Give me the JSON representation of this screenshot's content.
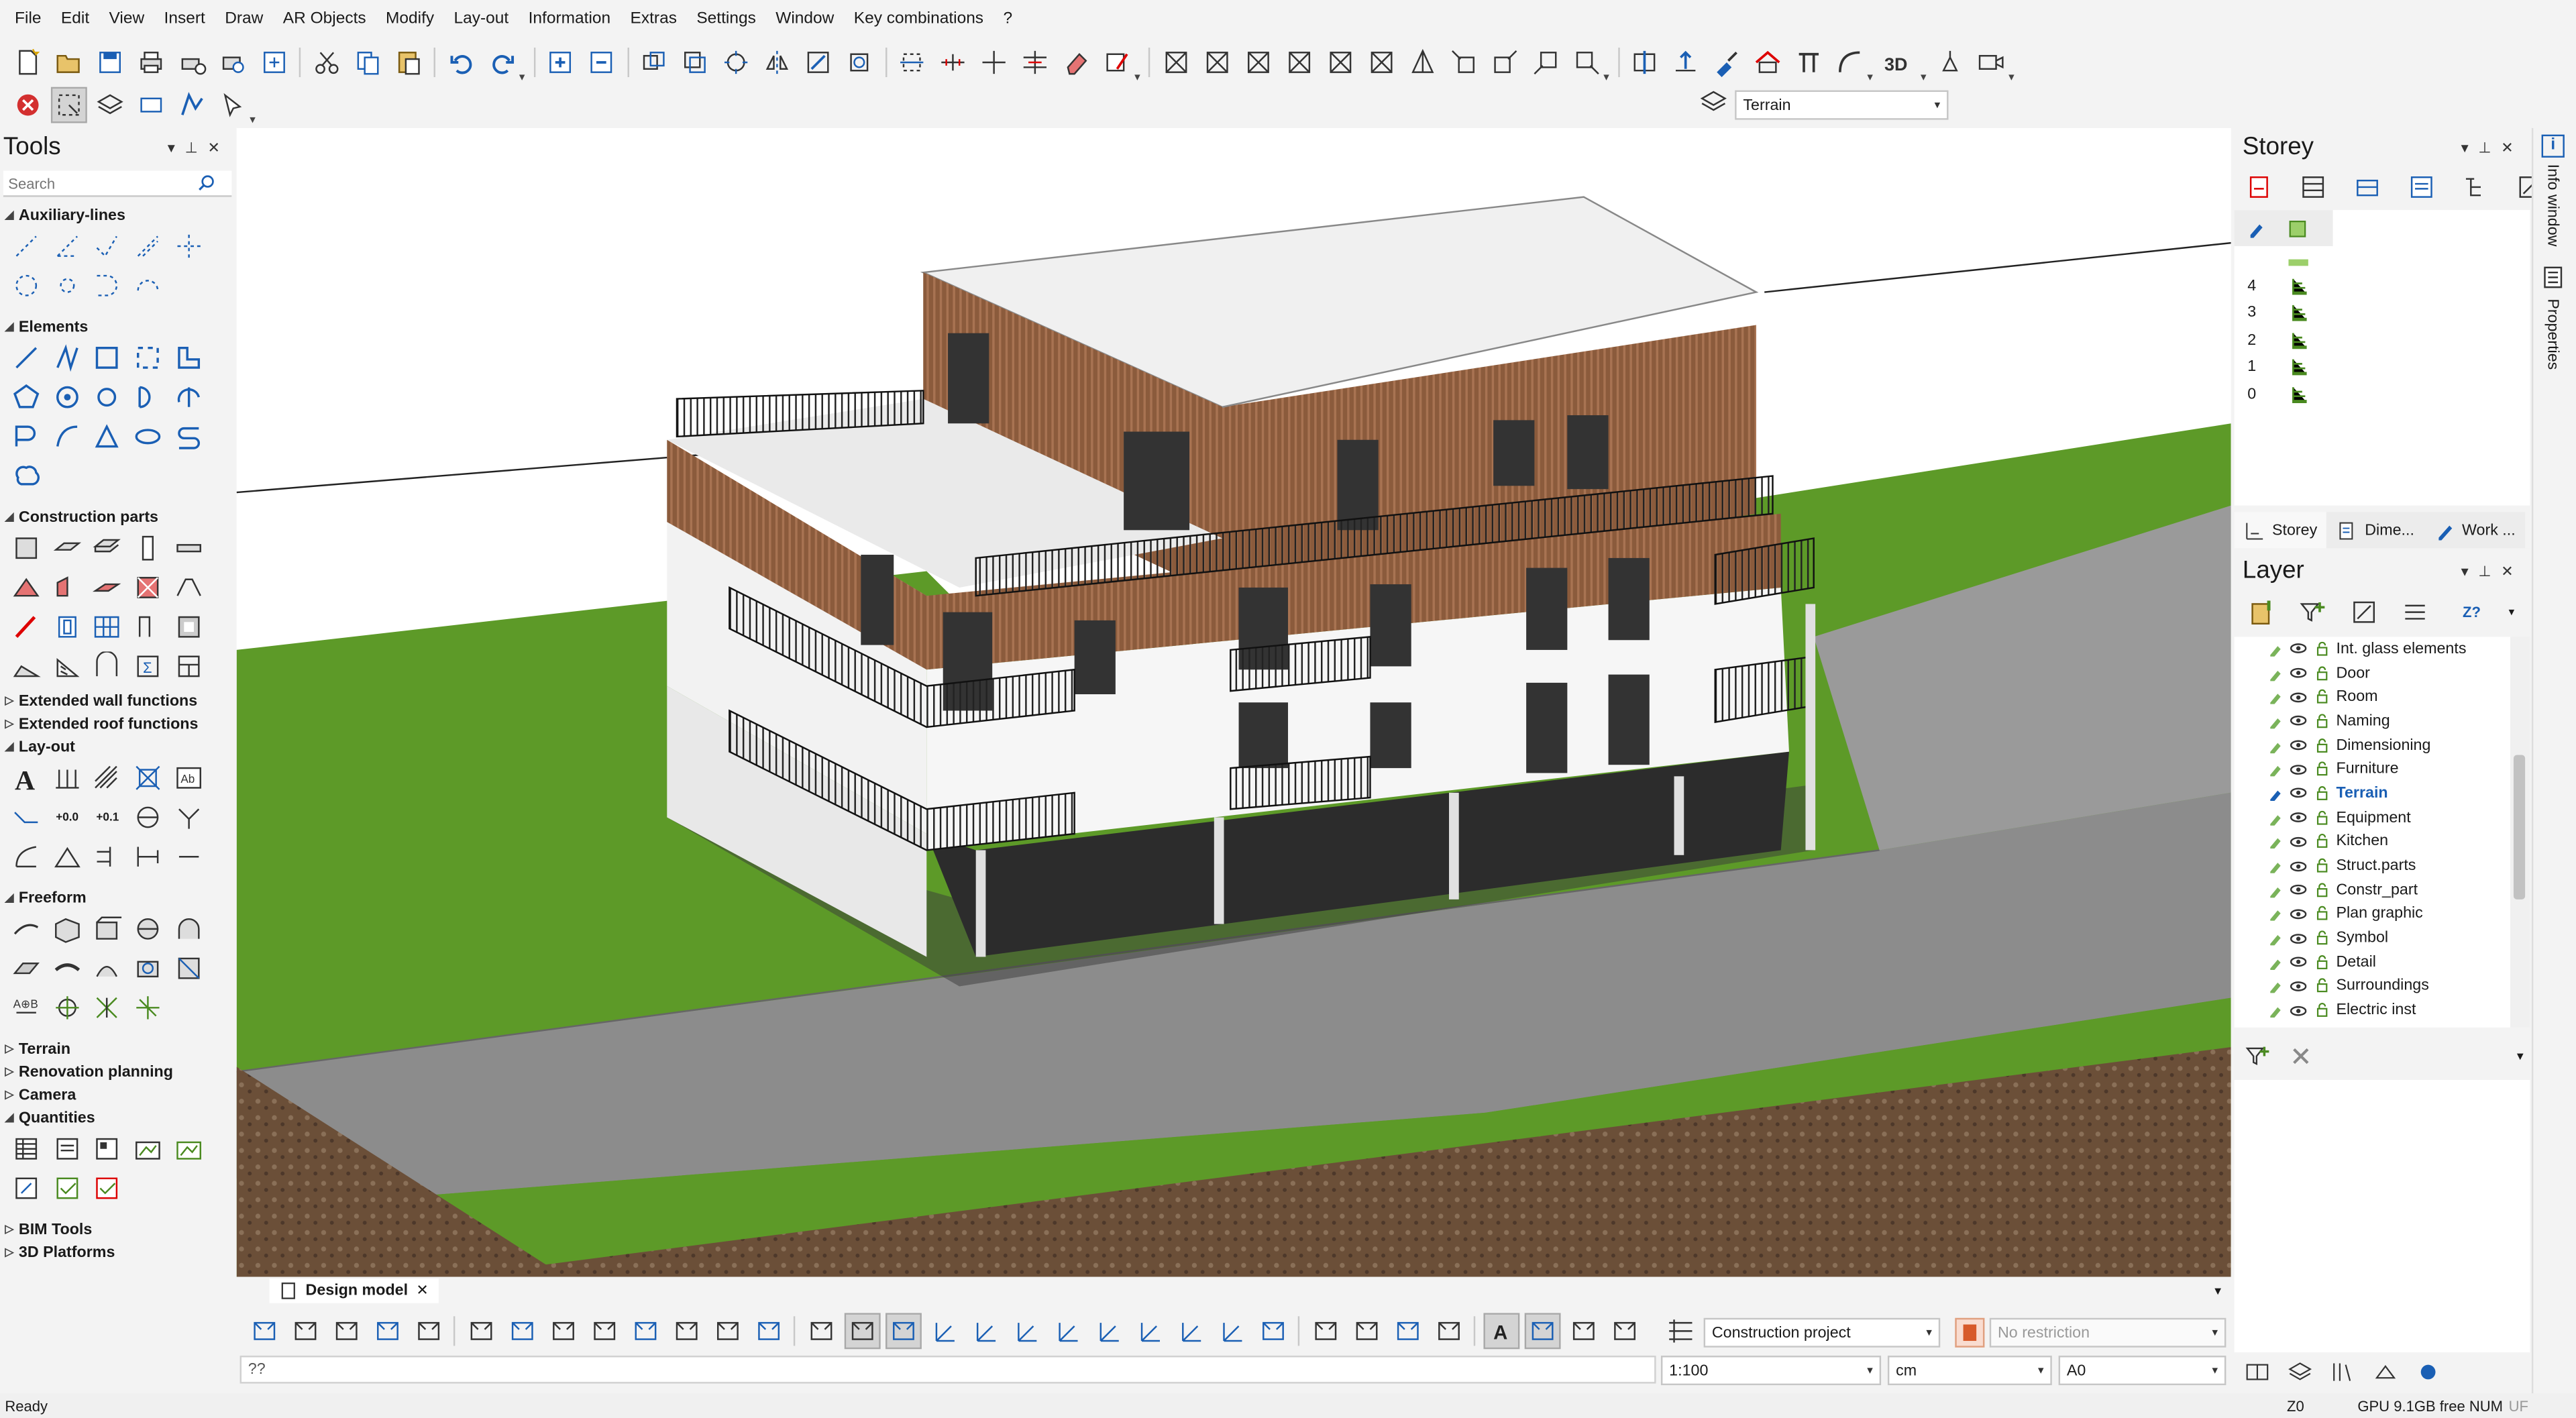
{
  "menu": [
    "File",
    "Edit",
    "View",
    "Insert",
    "Draw",
    "AR Objects",
    "Modify",
    "Lay-out",
    "Information",
    "Extras",
    "Settings",
    "Window",
    "Key combinations",
    "?"
  ],
  "toolbar": {
    "layer_combo_value": "Terrain"
  },
  "tools": {
    "title": "Tools",
    "search_placeholder": "Search",
    "categories": {
      "auxiliary": "Auxiliary-lines",
      "elements": "Elements",
      "construction": "Construction parts",
      "ext_wall": "Extended wall functions",
      "ext_roof": "Extended roof functions",
      "layout": "Lay-out",
      "freeform": "Freeform",
      "terrain": "Terrain",
      "renovation": "Renovation planning",
      "camera": "Camera",
      "quantities": "Quantities",
      "bim": "BIM Tools",
      "platforms": "3D Platforms"
    },
    "layout_labels": {
      "plus": "+0.0",
      "plus01": "+0.1"
    }
  },
  "storey": {
    "title": "Storey",
    "levels": [
      "4",
      "3",
      "2",
      "1",
      "0"
    ],
    "tabs": [
      "Storey",
      "Dime...",
      "Work ..."
    ]
  },
  "layer": {
    "title": "Layer",
    "sort_label": "Z?",
    "items": [
      {
        "name": "Int. glass elements",
        "active": false
      },
      {
        "name": "Door",
        "active": false
      },
      {
        "name": "Room",
        "active": false
      },
      {
        "name": "Naming",
        "active": false
      },
      {
        "name": "Dimensioning",
        "active": false
      },
      {
        "name": "Furniture",
        "active": false
      },
      {
        "name": "Terrain",
        "active": true
      },
      {
        "name": "Equipment",
        "active": false
      },
      {
        "name": "Kitchen",
        "active": false
      },
      {
        "name": "Struct.parts",
        "active": false
      },
      {
        "name": "Constr_part",
        "active": false
      },
      {
        "name": "Plan graphic",
        "active": false
      },
      {
        "name": "Symbol",
        "active": false
      },
      {
        "name": "Detail",
        "active": false
      },
      {
        "name": "Surroundings",
        "active": false
      },
      {
        "name": "Electric inst",
        "active": false
      }
    ]
  },
  "sidetabs": [
    "Info window",
    "Properties"
  ],
  "document_tab": "Design model",
  "bottom": {
    "project_combo": "Construction project",
    "restriction_placeholder": "No restriction",
    "command_value": "??",
    "scale": "1:100",
    "unit": "cm",
    "paper": "A0"
  },
  "status": {
    "left": "Ready",
    "z": "Z0",
    "gpu": "GPU 9.1GB free",
    "num": "NUM",
    "uf": "UF"
  },
  "colors": {
    "accent_blue": "#1a5fb4",
    "grass": "#5d9a28",
    "wood": "#8a5a3a",
    "road": "#8c8c8c",
    "panel_bg": "#f3f3f3"
  }
}
